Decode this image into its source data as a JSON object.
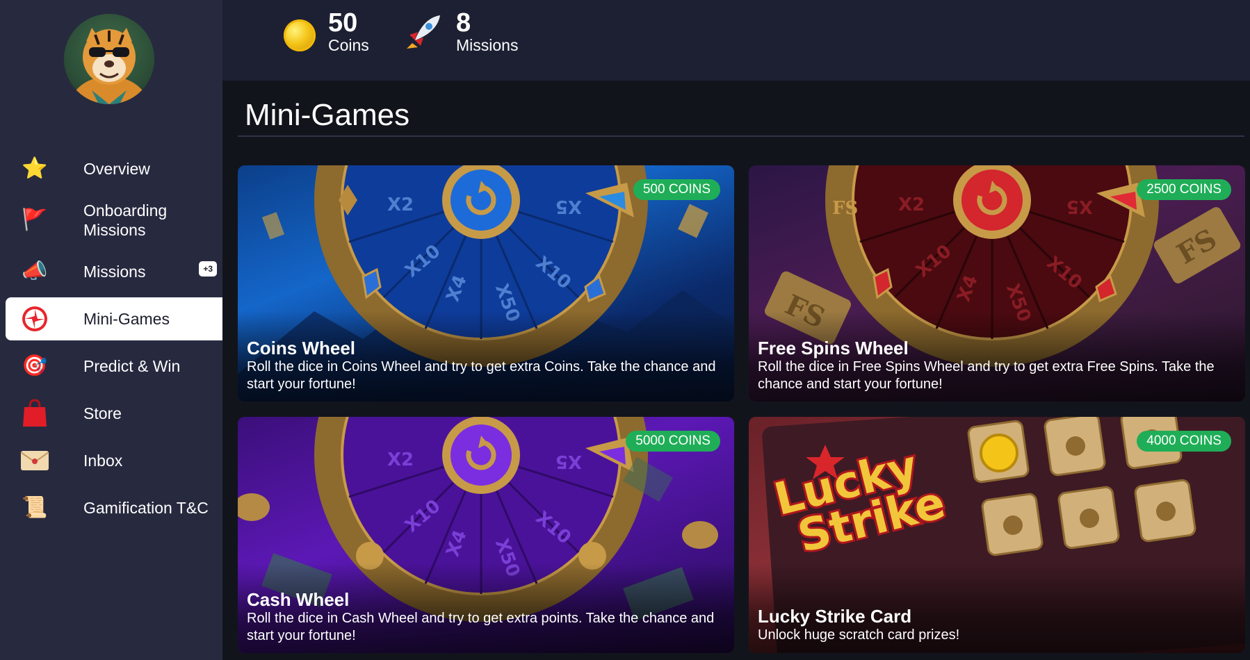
{
  "sidebar": {
    "avatar_alt": "tiger-avatar",
    "items": [
      {
        "label": "Overview",
        "icon": "star-icon",
        "glyph": "⭐"
      },
      {
        "label": "Onboarding\nMissions",
        "icon": "flags-icon",
        "glyph": "🚩"
      },
      {
        "label": "Missions",
        "icon": "megaphone-icon",
        "glyph": "📣",
        "badge": "+3"
      },
      {
        "label": "Mini-Games",
        "icon": "wheel-icon",
        "glyph": "🎡"
      },
      {
        "label": "Predict & Win",
        "icon": "target-icon",
        "glyph": "🎯"
      },
      {
        "label": "Store",
        "icon": "shopping-bag-icon",
        "glyph": "🛍"
      },
      {
        "label": "Inbox",
        "icon": "envelope-icon",
        "glyph": "✉"
      },
      {
        "label": "Gamification T&C",
        "icon": "scroll-icon",
        "glyph": "📜"
      }
    ]
  },
  "stats": {
    "coins_value": "50",
    "coins_label": "Coins",
    "missions_value": "8",
    "missions_label": "Missions"
  },
  "page": {
    "title": "Mini-Games"
  },
  "games": [
    {
      "title": "Coins Wheel",
      "badge": "500 COINS",
      "description": "Roll the dice in Coins Wheel and try to get extra Coins. Take the chance and start your fortune!",
      "theme": "#1c6fd6"
    },
    {
      "title": "Free Spins Wheel",
      "badge": "2500 COINS",
      "description": "Roll the dice in Free Spins Wheel and try to get extra Free Spins. Take the chance and start your fortune!",
      "theme": "#b3121c"
    },
    {
      "title": "Cash Wheel",
      "badge": "5000 COINS",
      "description": "Roll the dice in Cash Wheel and try to get extra points. Take the chance and start your fortune!",
      "theme": "#6b1fd0"
    },
    {
      "title": "Lucky Strike Card",
      "badge": "4000 COINS",
      "description": "Unlock huge scratch card prizes!",
      "theme": "#7a2a30",
      "art_text": "Lucky Strike"
    }
  ]
}
